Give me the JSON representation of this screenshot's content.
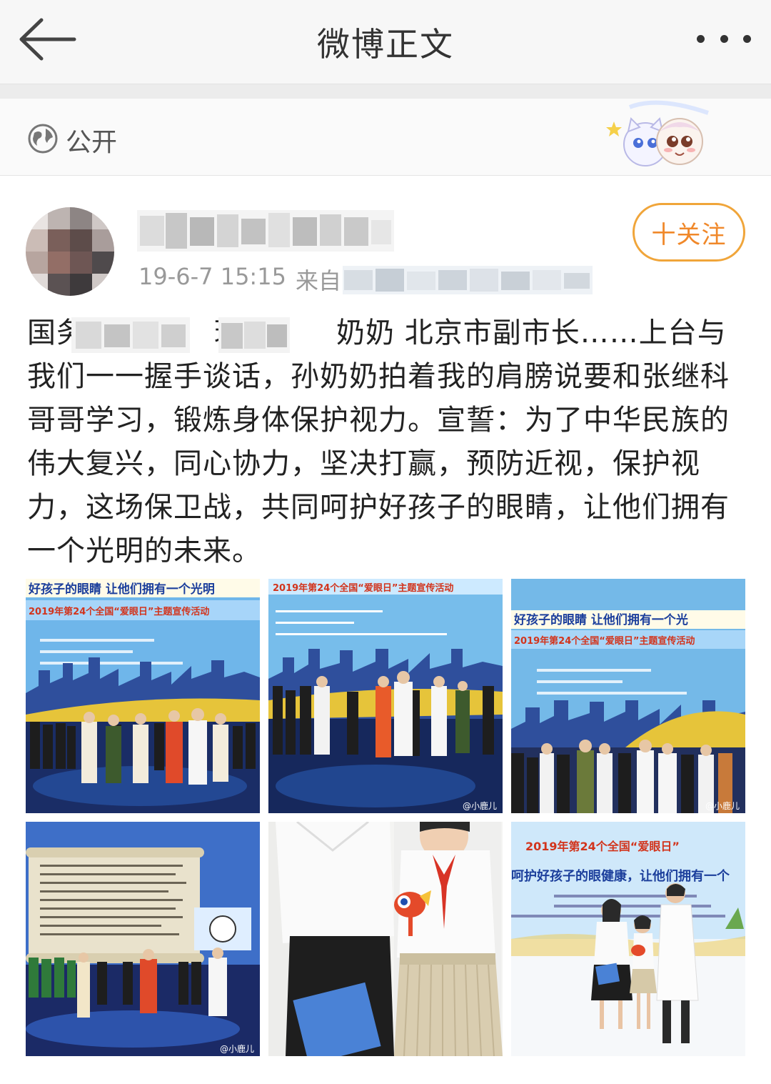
{
  "nav": {
    "title": "微博正文",
    "back_icon": "arrow-left-icon",
    "more_icon": "more-dots-icon"
  },
  "visibility": {
    "label": "公开",
    "icon": "globe-icon"
  },
  "author": {
    "post_time": "19-6-7 15:15",
    "source_prefix": "来自",
    "follow_label": "十关注"
  },
  "post": {
    "text_prefix": "国务",
    "text_mid": "理",
    "text_mid2": "奶奶 北京市副市长……上台与我们一一握手谈话，孙奶奶拍着我的肩膀说要和张继科哥哥学习，锻炼身体保护视力。宣誓：为了中华民族的伟大复兴，同心协力，坚决打赢，预防近视，保护视力，这场保卫战，共同呵护好孩子的眼睛，让他们拥有一个光明的未来。"
  },
  "photos": {
    "p1_banner_top": "好孩子的眼睛 让他们拥有一个光明",
    "p1_banner_sub": "2019年第24个全国“爱眼日”主题宣传活动",
    "p2_banner_top": "2019年第24个全国“爱眼日”主题宣传活动",
    "p3_banner_top": "好孩子的眼睛 让他们拥有一个光",
    "p3_banner_sub": "2019年第24个全国“爱眼日”主题宣传活动",
    "p6_banner_top": "2019年第24个全国“爱眼日”",
    "p6_banner_sub": "呵护好孩子的眼健康，让他们拥有一个",
    "watermark": "@小鹿儿"
  },
  "colors": {
    "accent": "#f0882a",
    "nav_bg": "#f7f7f7",
    "text": "#222222",
    "meta": "#999999"
  }
}
